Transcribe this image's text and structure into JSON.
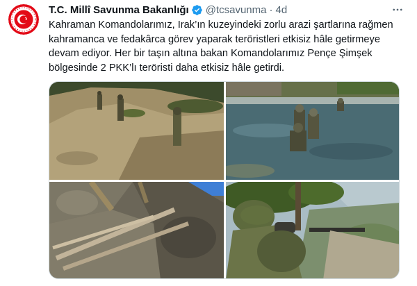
{
  "tweet": {
    "display_name": "T.C. Millî Savunma Bakanlığı",
    "handle": "@tcsavunma",
    "separator": "·",
    "time": "4d",
    "text": "Kahraman Komandolarımız, Irak’ın kuzeyindeki zorlu arazi şartlarına rağmen kahramanca ve fedakârca görev yaparak teröristleri etkisiz hâle getirmeye devam ediyor. Her bir taşın altına bakan Komandolarımız Pençe Şimşek bölgesinde 2 PKK’lı teröristi daha etkisiz hâle getirdi.",
    "verified_color": "#1d9bf0",
    "avatar_colors": {
      "ring": "#e30a17",
      "inner": "#ffffff"
    }
  },
  "icons": {
    "avatar": "mod-emblem-icon",
    "verified": "verified-badge-icon",
    "more": "more-options-icon"
  },
  "media": {
    "count": 4
  }
}
